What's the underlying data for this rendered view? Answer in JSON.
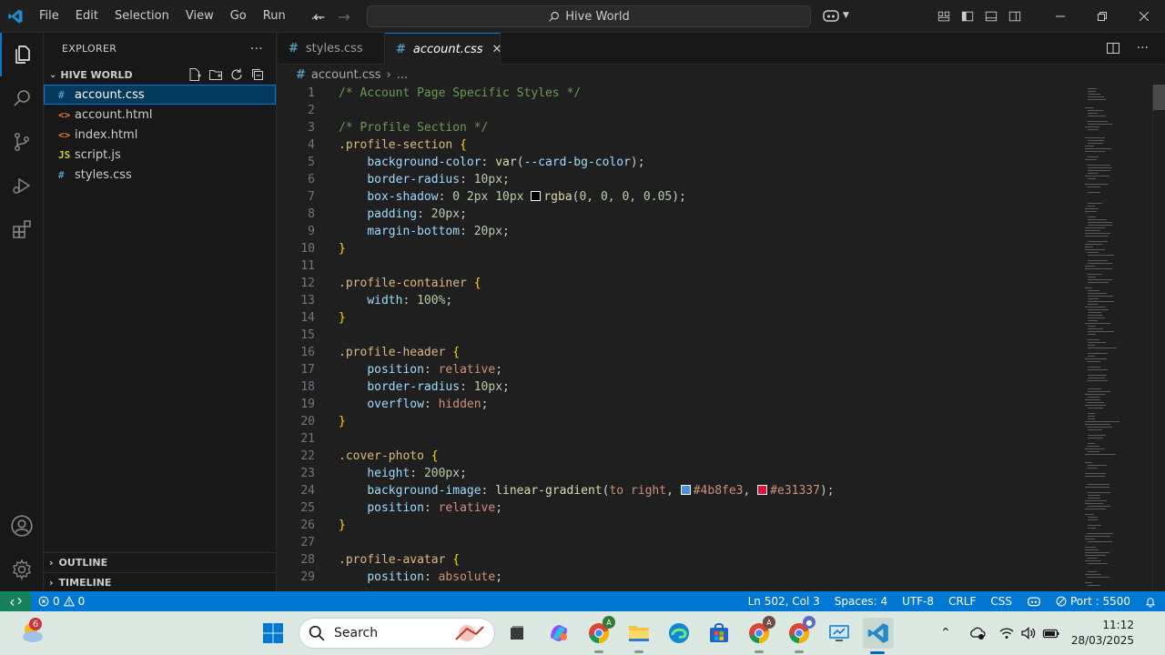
{
  "titlebar": {
    "menus": [
      "File",
      "Edit",
      "Selection",
      "View",
      "Go",
      "Run",
      "..."
    ],
    "search_label": "Hive World"
  },
  "explorer": {
    "header": "EXPLORER",
    "folder": "HIVE WORLD",
    "files": [
      {
        "icon": "#",
        "name": "account.css",
        "selected": true,
        "icon_color": "#519aba"
      },
      {
        "icon": "<>",
        "name": "account.html",
        "selected": false,
        "icon_color": "#e37933"
      },
      {
        "icon": "<>",
        "name": "index.html",
        "selected": false,
        "icon_color": "#e37933"
      },
      {
        "icon": "JS",
        "name": "script.js",
        "selected": false,
        "icon_color": "#cbcb41"
      },
      {
        "icon": "#",
        "name": "styles.css",
        "selected": false,
        "icon_color": "#519aba"
      }
    ],
    "outline_label": "OUTLINE",
    "timeline_label": "TIMELINE"
  },
  "tabs": [
    {
      "name": "styles.css",
      "active": false
    },
    {
      "name": "account.css",
      "active": true
    }
  ],
  "breadcrumb": {
    "file": "account.css",
    "rest": "..."
  },
  "code": [
    {
      "n": "1",
      "tokens": [
        [
          "c-comment",
          "/* Account Page Specific Styles */"
        ]
      ]
    },
    {
      "n": "2",
      "tokens": []
    },
    {
      "n": "3",
      "tokens": [
        [
          "c-comment",
          "/* Profile Section */"
        ]
      ]
    },
    {
      "n": "4",
      "tokens": [
        [
          "c-sel",
          ".profile-section"
        ],
        [
          "c-punc",
          " "
        ],
        [
          "c-brace",
          "{"
        ]
      ]
    },
    {
      "n": "5",
      "tokens": [
        [
          "c-punc",
          "    "
        ],
        [
          "c-prop",
          "background-color"
        ],
        [
          "c-punc",
          ": "
        ],
        [
          "c-fn",
          "var"
        ],
        [
          "c-punc",
          "("
        ],
        [
          "c-var",
          "--card-bg-color"
        ],
        [
          "c-punc",
          ");"
        ]
      ]
    },
    {
      "n": "6",
      "tokens": [
        [
          "c-punc",
          "    "
        ],
        [
          "c-prop",
          "border-radius"
        ],
        [
          "c-punc",
          ": "
        ],
        [
          "c-num",
          "10px"
        ],
        [
          "c-punc",
          ";"
        ]
      ]
    },
    {
      "n": "7",
      "tokens": [
        [
          "c-punc",
          "    "
        ],
        [
          "c-prop",
          "box-shadow"
        ],
        [
          "c-punc",
          ": "
        ],
        [
          "c-num",
          "0 2px 10px "
        ],
        [
          "swatch",
          "#000000"
        ],
        [
          "c-fn",
          "rgba"
        ],
        [
          "c-punc",
          "("
        ],
        [
          "c-num",
          "0, 0, 0, 0.05"
        ],
        [
          "c-punc",
          ");"
        ]
      ]
    },
    {
      "n": "8",
      "tokens": [
        [
          "c-punc",
          "    "
        ],
        [
          "c-prop",
          "padding"
        ],
        [
          "c-punc",
          ": "
        ],
        [
          "c-num",
          "20px"
        ],
        [
          "c-punc",
          ";"
        ]
      ]
    },
    {
      "n": "9",
      "tokens": [
        [
          "c-punc",
          "    "
        ],
        [
          "c-prop",
          "margin-bottom"
        ],
        [
          "c-punc",
          ": "
        ],
        [
          "c-num",
          "20px"
        ],
        [
          "c-punc",
          ";"
        ]
      ]
    },
    {
      "n": "10",
      "tokens": [
        [
          "c-brace",
          "}"
        ]
      ]
    },
    {
      "n": "11",
      "tokens": []
    },
    {
      "n": "12",
      "tokens": [
        [
          "c-sel",
          ".profile-container"
        ],
        [
          "c-punc",
          " "
        ],
        [
          "c-brace",
          "{"
        ]
      ]
    },
    {
      "n": "13",
      "tokens": [
        [
          "c-punc",
          "    "
        ],
        [
          "c-prop",
          "width"
        ],
        [
          "c-punc",
          ": "
        ],
        [
          "c-num",
          "100%"
        ],
        [
          "c-punc",
          ";"
        ]
      ]
    },
    {
      "n": "14",
      "tokens": [
        [
          "c-brace",
          "}"
        ]
      ]
    },
    {
      "n": "15",
      "tokens": []
    },
    {
      "n": "16",
      "tokens": [
        [
          "c-sel",
          ".profile-header"
        ],
        [
          "c-punc",
          " "
        ],
        [
          "c-brace",
          "{"
        ]
      ]
    },
    {
      "n": "17",
      "tokens": [
        [
          "c-punc",
          "    "
        ],
        [
          "c-prop",
          "position"
        ],
        [
          "c-punc",
          ": "
        ],
        [
          "c-val",
          "relative"
        ],
        [
          "c-punc",
          ";"
        ]
      ]
    },
    {
      "n": "18",
      "tokens": [
        [
          "c-punc",
          "    "
        ],
        [
          "c-prop",
          "border-radius"
        ],
        [
          "c-punc",
          ": "
        ],
        [
          "c-num",
          "10px"
        ],
        [
          "c-punc",
          ";"
        ]
      ]
    },
    {
      "n": "19",
      "tokens": [
        [
          "c-punc",
          "    "
        ],
        [
          "c-prop",
          "overflow"
        ],
        [
          "c-punc",
          ": "
        ],
        [
          "c-val",
          "hidden"
        ],
        [
          "c-punc",
          ";"
        ]
      ]
    },
    {
      "n": "20",
      "tokens": [
        [
          "c-brace",
          "}"
        ]
      ]
    },
    {
      "n": "21",
      "tokens": []
    },
    {
      "n": "22",
      "tokens": [
        [
          "c-sel",
          ".cover-photo"
        ],
        [
          "c-punc",
          " "
        ],
        [
          "c-brace",
          "{"
        ]
      ]
    },
    {
      "n": "23",
      "tokens": [
        [
          "c-punc",
          "    "
        ],
        [
          "c-prop",
          "height"
        ],
        [
          "c-punc",
          ": "
        ],
        [
          "c-num",
          "200px"
        ],
        [
          "c-punc",
          ";"
        ]
      ]
    },
    {
      "n": "24",
      "tokens": [
        [
          "c-punc",
          "    "
        ],
        [
          "c-prop",
          "background-image"
        ],
        [
          "c-punc",
          ": "
        ],
        [
          "c-fn",
          "linear-gradient"
        ],
        [
          "c-punc",
          "("
        ],
        [
          "c-val",
          "to right"
        ],
        [
          "c-punc",
          ", "
        ],
        [
          "swatch",
          "#4b8fe3"
        ],
        [
          "c-val",
          "#4b8fe3"
        ],
        [
          "c-punc",
          ", "
        ],
        [
          "swatch",
          "#e31337"
        ],
        [
          "c-val",
          "#e31337"
        ],
        [
          "c-punc",
          ");"
        ]
      ]
    },
    {
      "n": "25",
      "tokens": [
        [
          "c-punc",
          "    "
        ],
        [
          "c-prop",
          "position"
        ],
        [
          "c-punc",
          ": "
        ],
        [
          "c-val",
          "relative"
        ],
        [
          "c-punc",
          ";"
        ]
      ]
    },
    {
      "n": "26",
      "tokens": [
        [
          "c-brace",
          "}"
        ]
      ]
    },
    {
      "n": "27",
      "tokens": []
    },
    {
      "n": "28",
      "tokens": [
        [
          "c-sel",
          ".profile-avatar"
        ],
        [
          "c-punc",
          " "
        ],
        [
          "c-brace",
          "{"
        ]
      ]
    },
    {
      "n": "29",
      "tokens": [
        [
          "c-punc",
          "    "
        ],
        [
          "c-prop",
          "position"
        ],
        [
          "c-punc",
          ": "
        ],
        [
          "c-val",
          "absolute"
        ],
        [
          "c-punc",
          ";"
        ]
      ]
    }
  ],
  "statusbar": {
    "errors": "0",
    "warnings": "0",
    "position": "Ln 502, Col 3",
    "spaces": "Spaces: 4",
    "encoding": "UTF-8",
    "eol": "CRLF",
    "language": "CSS",
    "port": "Port : 5500"
  },
  "taskbar": {
    "weather_badge": "6",
    "search_label": "Search",
    "time": "11:12",
    "date": "28/03/2025"
  },
  "colors": {
    "accent": "#0078d4",
    "remote": "#16825d"
  }
}
